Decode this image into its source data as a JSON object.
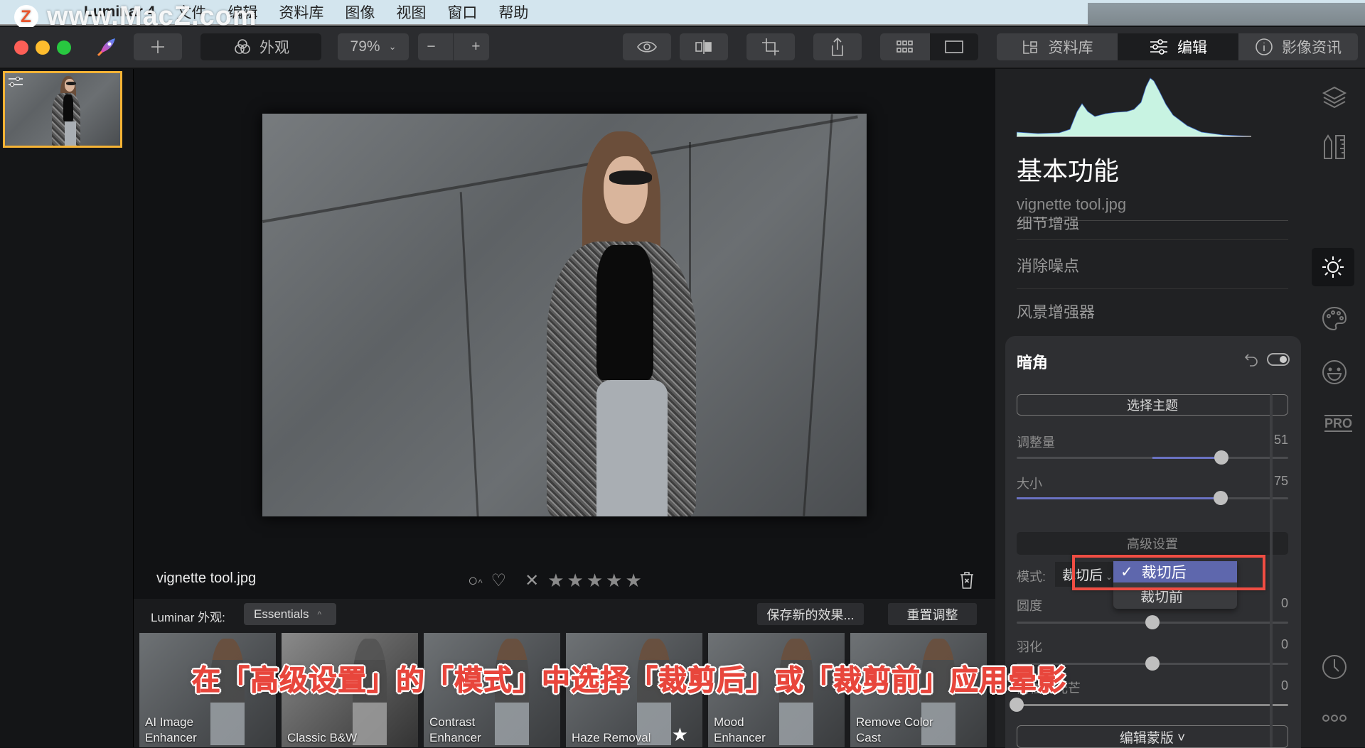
{
  "watermark": "www.MacZ.com",
  "menubar": {
    "app_name": "Luminar 4",
    "items": [
      "文件",
      "编辑",
      "资料库",
      "图像",
      "视图",
      "窗口",
      "帮助"
    ]
  },
  "toolbar": {
    "add_icon": "plus-icon",
    "looks_label": "外观",
    "zoom_level": "79%",
    "zoom_out": "−",
    "zoom_in": "+",
    "tabs": [
      {
        "label": "资料库",
        "icon": "library-icon",
        "active": false
      },
      {
        "label": "编辑",
        "icon": "sliders-icon",
        "active": true
      },
      {
        "label": "影像资讯",
        "icon": "info-icon",
        "active": false
      }
    ]
  },
  "image": {
    "filename": "vignette tool.jpg",
    "rating_stars": 5,
    "star_glyph": "★"
  },
  "looks_bar": {
    "label": "Luminar 外观:",
    "collection": "Essentials",
    "save_button": "保存新的效果...",
    "reset_button": "重置调整",
    "presets": [
      {
        "name_line1": "AI Image",
        "name_line2": "Enhancer",
        "favorite": false
      },
      {
        "name_line1": "Classic B&W",
        "name_line2": "",
        "favorite": false
      },
      {
        "name_line1": "Contrast",
        "name_line2": "Enhancer",
        "favorite": false
      },
      {
        "name_line1": "Haze Removal",
        "name_line2": "",
        "favorite": true
      },
      {
        "name_line1": "Mood",
        "name_line2": "Enhancer",
        "favorite": false
      },
      {
        "name_line1": "Remove Color",
        "name_line2": "Cast",
        "favorite": false
      }
    ]
  },
  "caption": "在「高级设置」的「模式」中选择「裁剪后」或「裁剪前」应用晕影",
  "right_panel": {
    "section_title": "基本功能",
    "file_name": "vignette tool.jpg",
    "tools": [
      "细节增强",
      "消除噪点",
      "风景增强器"
    ],
    "vignette": {
      "title": "暗角",
      "select_subject": "选择主题",
      "sliders": [
        {
          "label": "调整量",
          "value": 51,
          "min": -100,
          "max": 100
        },
        {
          "label": "大小",
          "value": 75,
          "min": 0,
          "max": 100
        }
      ],
      "advanced_label": "高级设置",
      "mode_label": "模式:",
      "mode_value": "裁切后",
      "mode_options": [
        {
          "label": "裁切后",
          "selected": true
        },
        {
          "label": "裁切前",
          "selected": false
        }
      ],
      "adv_sliders": [
        {
          "label": "圆度",
          "value": 0,
          "min": -100,
          "max": 100
        },
        {
          "label": "羽化",
          "value": 0,
          "min": -100,
          "max": 100
        },
        {
          "label": "内在的光芒",
          "value": 0,
          "min": 0,
          "max": 100
        }
      ],
      "edit_mask": "编辑蒙版 ˅"
    }
  },
  "side_icons": [
    "layers-icon",
    "canvas-tools-icon",
    "essentials-sun-icon",
    "creative-palette-icon",
    "portrait-face-icon",
    "pro-icon",
    "history-clock-icon",
    "more-icon"
  ],
  "side_pro_label": "PRO",
  "colors": {
    "accent": "#6a72c2",
    "highlight": "#ef4d43",
    "thumb_border": "#f5b335"
  }
}
